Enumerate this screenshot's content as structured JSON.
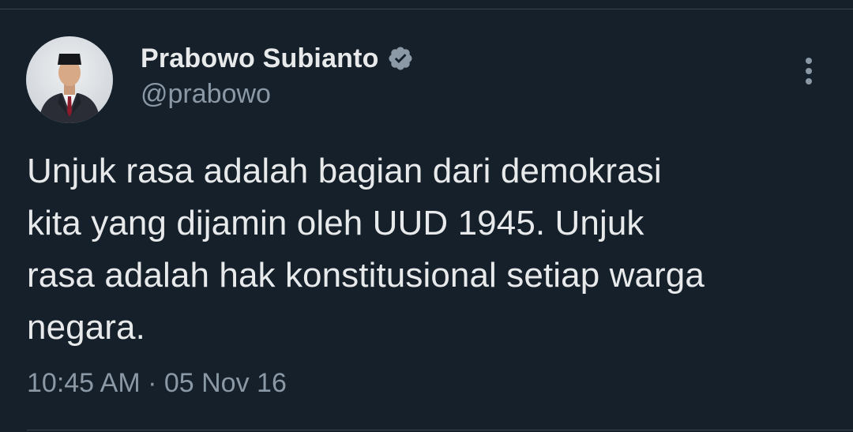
{
  "author": {
    "display_name": "Prabowo Subianto",
    "handle": "@prabowo",
    "verified": true,
    "avatar_icon": "profile-photo"
  },
  "tweet": {
    "text": "Unjuk rasa adalah bagian dari demokrasi\nkita yang dijamin oleh UUD 1945. Unjuk\nrasa adalah hak konstitusional setiap warga\nnegara.",
    "timestamp": "10:45 AM · 05 Nov 16"
  },
  "icons": {
    "verified": "verified-badge-icon",
    "more": "more-options-icon"
  },
  "colors": {
    "background": "#15202b",
    "primary_text": "#e7e9ea",
    "secondary_text": "#8b98a5",
    "verified_badge": "#8b98a5",
    "divider": "#38444d"
  }
}
